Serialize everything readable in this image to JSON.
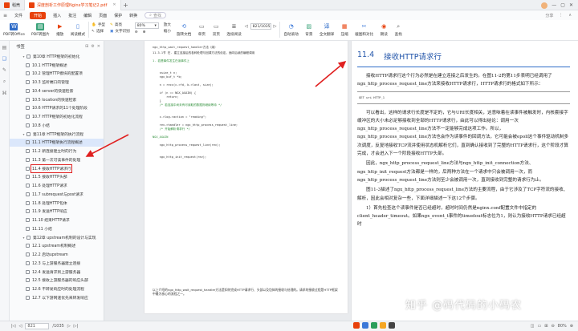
{
  "tabs": [
    {
      "label": "稻壳",
      "color": "#e8410b"
    },
    {
      "label": "深度剖析工作原理Nginx学习笔记2.pdf",
      "color": "#e8410b"
    }
  ],
  "window": {
    "add_tab": "+",
    "avatar": "用户头像"
  },
  "menu": {
    "hamburger": "≡",
    "items": [
      "文件",
      "开始",
      "插入",
      "批注",
      "编辑",
      "页面",
      "保护",
      "转换"
    ],
    "active": "开始",
    "find": "查找",
    "right": [
      "分享",
      "⋮",
      "∧"
    ]
  },
  "toolbar": {
    "left": [
      {
        "label": "PDF转Office",
        "icon": "W",
        "color": "#2f6cc8"
      },
      {
        "label": "PDF转图片",
        "icon": "▤",
        "color": "#3aa37a"
      },
      {
        "label": "播放",
        "icon": "▶",
        "color": "#e8410b"
      },
      {
        "label": "阅读模式",
        "icon": "▯",
        "color": "#3b78d8"
      }
    ],
    "col1": [
      "手型",
      "选择"
    ],
    "col2": [
      "高亮",
      "文字识别"
    ],
    "zoom": "80%",
    "col3": [
      "放大",
      "缩小"
    ],
    "icons": [
      {
        "label": "旋转文档",
        "icon": "⟲",
        "color": "#3b78d8"
      },
      {
        "label": "单页",
        "icon": "▭",
        "color": "#666"
      },
      {
        "label": "双页",
        "icon": "▭",
        "color": "#666"
      },
      {
        "label": "连续阅读",
        "icon": "≣",
        "color": "#666"
      }
    ],
    "page_value": "821/1035",
    "right": [
      {
        "label": "自动滚动",
        "icon": "◔",
        "color": "#3b78d8"
      },
      {
        "label": "背景",
        "icon": "▨",
        "color": "#3aa37a"
      },
      {
        "label": "全文翻译",
        "icon": "译",
        "color": "#2f6cc8"
      },
      {
        "label": "压缩",
        "icon": "▦",
        "color": "#e8410b"
      },
      {
        "label": "截图和对比",
        "icon": "✂",
        "color": "#3b78d8"
      },
      {
        "label": "朗读",
        "icon": "◉",
        "color": "#e8410b"
      },
      {
        "label": "查找",
        "icon": "⌕",
        "color": "#666"
      }
    ]
  },
  "sidebar": {
    "title": "书签",
    "items": [
      {
        "label": "第10章 HTTP框架的初始化",
        "level": 1,
        "arrow": "▾"
      },
      {
        "label": "10.1 HTTP框架概述",
        "level": 2
      },
      {
        "label": "10.2 管理HTTP模块的配置项",
        "level": 2
      },
      {
        "label": "10.3 监听端口的管理",
        "level": 2
      },
      {
        "label": "10.4 server的快速检索",
        "level": 2
      },
      {
        "label": "10.5 location的快速检索",
        "level": 2
      },
      {
        "label": "10.6 HTTP请求的11个处理阶段",
        "level": 2
      },
      {
        "label": "10.7 HTTP框架的初始化流程",
        "level": 2
      },
      {
        "label": "10.8 小结",
        "level": 2
      },
      {
        "label": "第11章 HTTP框架的执行流程",
        "level": 1,
        "arrow": "▾"
      },
      {
        "label": "11.1 HTTP框架执行流程概述",
        "level": 2,
        "selected": true
      },
      {
        "label": "11.2 新连接建立时的行为",
        "level": 2
      },
      {
        "label": "11.3 第一次可读事件的处理",
        "level": 2
      },
      {
        "label": "11.4 接收HTTP请求行",
        "level": 2,
        "boxed": true
      },
      {
        "label": "11.5 接收HTTP头部",
        "level": 2
      },
      {
        "label": "11.6 处理HTTP请求",
        "level": 2
      },
      {
        "label": "11.7 subrequest与post请求",
        "level": 2
      },
      {
        "label": "11.8 处理HTTP包体",
        "level": 2
      },
      {
        "label": "11.9 发送HTTP响应",
        "level": 2
      },
      {
        "label": "11.10 结束HTTP请求",
        "level": 2
      },
      {
        "label": "11.11 小结",
        "level": 2
      },
      {
        "label": "第12章 upstream机制的设计与实现",
        "level": 1,
        "arrow": "▾"
      },
      {
        "label": "12.1 upstream机制概述",
        "level": 2
      },
      {
        "label": "12.2 启动upstream",
        "level": 2
      },
      {
        "label": "12.3 与上游服务器建立连接",
        "level": 2
      },
      {
        "label": "12.4 发送请求到上游服务器",
        "level": 2
      },
      {
        "label": "12.5 接收上游服务器的响应头部",
        "level": 2
      },
      {
        "label": "12.6 不转发响应时的处理流程",
        "level": 2
      },
      {
        "label": "12.7 以下游网速优先来转发响应",
        "level": 2
      }
    ]
  },
  "page_left": {
    "header": "ngx_http_wait_request_handler方法（续）",
    "lines": [
      {
        "t": "11.3.1节 在. 建立连接后的各种处理与回调方法的设定。面向后续的编程调用",
        "g": false
      },
      {
        "t": "",
        "g": false
      },
      {
        "t": "1. 若是事件发生在读事件上",
        "g": true
      },
      {
        "t": "",
        "g": false
      },
      {
        "t": "",
        "g": false
      },
      {
        "t": "    ssize_t n;",
        "g": false
      },
      {
        "t": "    ngx_buf_t *b;",
        "g": false
      },
      {
        "t": "",
        "g": false
      },
      {
        "t": "    n = recv(c->fd, b->last, size);",
        "g": false
      },
      {
        "t": "",
        "g": false
      },
      {
        "t": "    if (n == NGX_AGAIN) {",
        "g": false
      },
      {
        "t": "        return;",
        "g": false
      },
      {
        "t": "    }",
        "g": false
      },
      {
        "t": "    /* 若连接中尚未有可读取的数据则继续等待 */",
        "g": true
      },
      {
        "t": "",
        "g": false
      },
      {
        "t": "",
        "g": false
      },
      {
        "t": "    c->log->action = \"reading\";",
        "g": false
      },
      {
        "t": "",
        "g": false
      },
      {
        "t": "    rev->handler = ngx_http_process_request_line;",
        "g": false
      },
      {
        "t": "    /* 开始解析请求行 */",
        "g": true
      },
      {
        "t": "",
        "g": false
      },
      {
        "t": "NGX_AGAIN",
        "g": true
      },
      {
        "t": "",
        "g": false
      },
      {
        "t": "    ngx_http_process_request_line(rev);",
        "g": false
      },
      {
        "t": "",
        "g": false
      },
      {
        "t": "",
        "g": false
      },
      {
        "t": "    ngx_http_init_request(rev);",
        "g": false
      },
      {
        "t": "",
        "g": false
      },
      {
        "t": "",
        "g": false
      }
    ],
    "footer": "以上介绍的ngx_http_wait_request_handler方法是如何完成HTTP请求行、头部以及包体的接收与处理的。请求的接收过程是HTTP框架中最为核心的流程之一。"
  },
  "page_right": {
    "heading_num": "11.4",
    "heading": "接收HTTP请求行",
    "p1": "接收HTTP请求行这个行为必然是在建立连接之后发生的。在图11-2的第11步表明已经调用了ngx_http_process_request_line方法来接收HTTP请求行，HTTP请求行的格式如下所示：",
    "code": "GET uri HTTP_1",
    "p2": "可以看出，这样的请求行长度是不定的，它与URI长度相关，这意味着在读事件被触发时，内核套接字缓冲区的大小未必足够接收到全部的HTTP请求行，由此可以得出结论：调用一次ngx_http_process_request_line方法不一定能够完成这项工作。所以，ngx_http_process_request_line方法也会作为读事件的回调方法，它可能会被epoll这个事件驱动机制多次调度，反复地接收TCP流并使用状态机解析它们，直到确认接收到了完整的HTTP请求行，这个阶段才算完成，才会进入下一个阶段接收HTTP头部。",
    "p3": "因此，ngx_http_process_request_line方法与ngx_http_init_connection方法、ngx_http_init_request方法都是一样的，后两种方法在一个请求中只会被调用一次，而ngx_http_process_request_line方法则至少会被调用一次，直到接收到完整的请求行为止。",
    "p4": "图11-3描述了ngx_http_process_request_line方法的主要流程，由于它涉及了TCP字符流的接收、解析，因此会相对复杂一些，下面详细描述一下这12个步骤。",
    "p5": "1）首先检查这个读事件是否已经超时，超时时间仍然是nginx.conf配置文件中指定的client_header_timeout。如果ngx_event_t事件的timedout标志位为1，则认为接收HTTP请求已经超时"
  },
  "watermark": "知乎 @码代码的小码农",
  "status": {
    "page": "821",
    "total": "/1035",
    "first": "|◁",
    "prev": "◁",
    "next": "▷",
    "last": "▷|",
    "zoom": "80%",
    "view_icons": [
      "◫",
      "▭",
      "⊞"
    ]
  },
  "tray": [
    {
      "color": "#e8410b"
    },
    {
      "color": "#3b78d8"
    },
    {
      "color": "#2a9d5a"
    },
    {
      "color": "#f5a623"
    },
    {
      "color": "#444"
    }
  ]
}
